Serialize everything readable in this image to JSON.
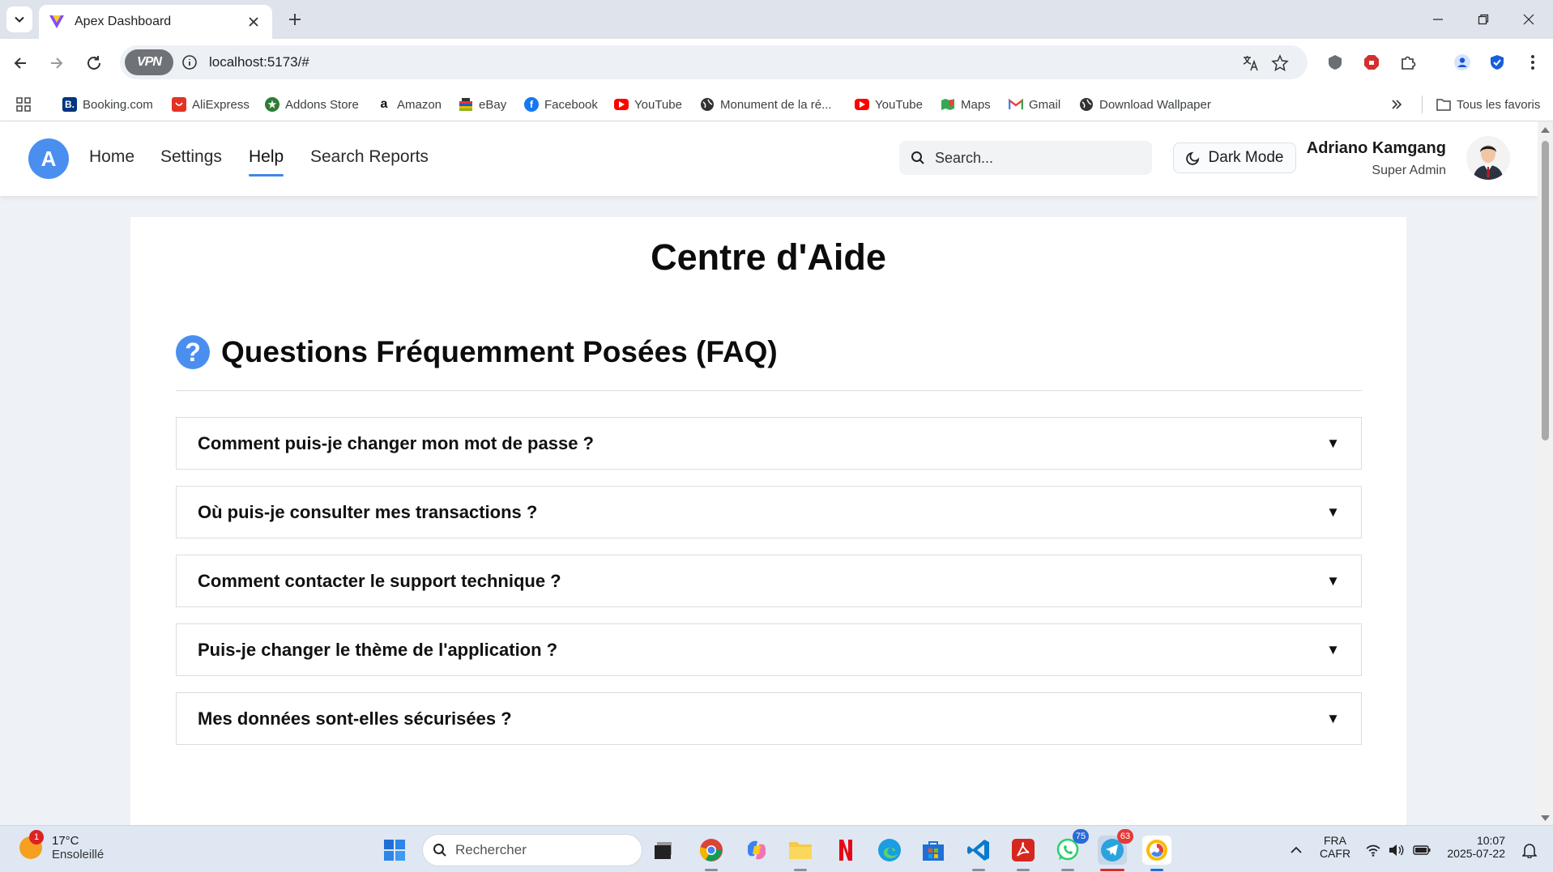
{
  "browser": {
    "tab_title": "Apex Dashboard",
    "url": "localhost:5173/#",
    "vpn_label": "VPN",
    "bookmarks": [
      {
        "label": "Booking.com",
        "color": "#003580",
        "glyph": "B."
      },
      {
        "label": "AliExpress",
        "color": "#e43225",
        "glyph": ""
      },
      {
        "label": "Addons Store",
        "color": "#2e7d32",
        "glyph": ""
      },
      {
        "label": "Amazon",
        "color": "#ffffff",
        "glyph": "a"
      },
      {
        "label": "eBay",
        "color": "#ffffff",
        "glyph": ""
      },
      {
        "label": "Facebook",
        "color": "#1877f2",
        "glyph": "f"
      },
      {
        "label": "YouTube",
        "color": "#ff0000",
        "glyph": ""
      },
      {
        "label": "Monument de la ré...",
        "color": "#ffffff",
        "glyph": ""
      },
      {
        "label": "YouTube",
        "color": "#ff0000",
        "glyph": ""
      },
      {
        "label": "Maps",
        "color": "#ffffff",
        "glyph": ""
      },
      {
        "label": "Gmail",
        "color": "#ffffff",
        "glyph": "M"
      },
      {
        "label": "Download Wallpaper",
        "color": "#ffffff",
        "glyph": ""
      }
    ],
    "all_bookmarks": "Tous les favoris"
  },
  "app": {
    "logo_letter": "A",
    "nav": [
      "Home",
      "Settings",
      "Help",
      "Search Reports"
    ],
    "active_nav": "Help",
    "search_placeholder": "Search...",
    "dark_mode_label": "Dark Mode",
    "user_name": "Adriano Kamgang",
    "user_role": "Super Admin"
  },
  "help": {
    "title": "Centre d'Aide",
    "faq_icon": "?",
    "faq_title": "Questions Fréquemment Posées (FAQ)",
    "arrow": "▼",
    "questions": [
      "Comment puis-je changer mon mot de passe ?",
      "Où puis-je consulter mes transactions ?",
      "Comment contacter le support technique ?",
      "Puis-je changer le thème de l'application ?",
      "Mes données sont-elles sécurisées ?"
    ]
  },
  "taskbar": {
    "weather_temp": "17°C",
    "weather_desc": "Ensoleillé",
    "weather_badge": "1",
    "search_label": "Rechercher",
    "whatsapp_badge": "75",
    "telegram_badge": "63",
    "lang_top": "FRA",
    "lang_bottom": "CAFR",
    "time": "10:07",
    "date": "2025-07-22"
  },
  "colors": {
    "accent": "#4a8ff0",
    "nav_underline": "#3f86ea"
  }
}
